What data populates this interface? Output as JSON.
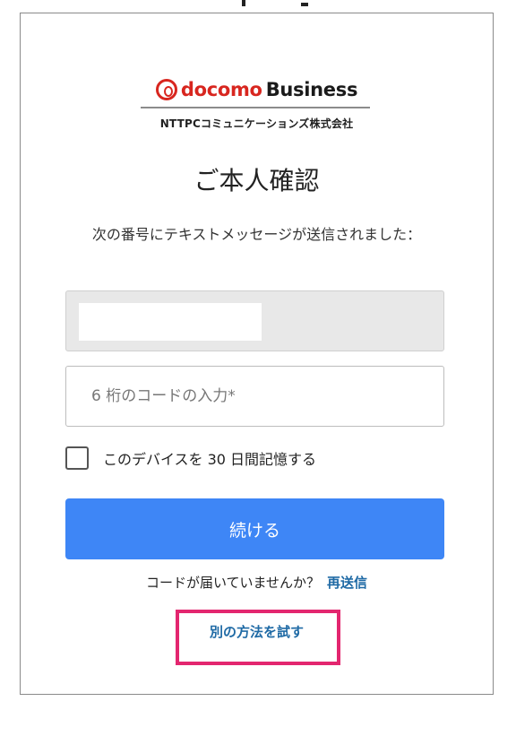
{
  "logo": {
    "brand_red": "docomo",
    "brand_black": "Business",
    "icon": "docomo-logo-icon",
    "brand_color": "#d8261f"
  },
  "company": "NTTPCコミュニケーションズ株式会社",
  "title": "ご本人確認",
  "message": "次の番号にテキストメッセージが送信されました：",
  "code_input": {
    "placeholder": "6 桁のコードの入力*",
    "value": ""
  },
  "remember": {
    "label": "このデバイスを 30 日間記憶する",
    "checked": false
  },
  "continue_button": "続ける",
  "resend": {
    "question": "コードが届いていませんか？",
    "link": "再送信"
  },
  "other_method": "別の方法を試す",
  "colors": {
    "accent_button": "#3e86f6",
    "link": "#1f6aa5",
    "highlight": "#e3266f"
  }
}
